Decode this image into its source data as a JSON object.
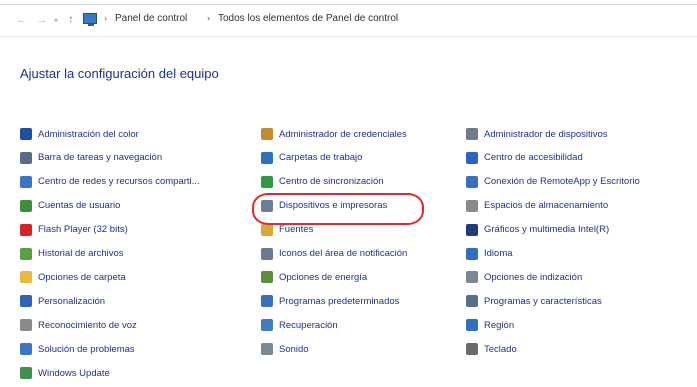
{
  "address_bar": {
    "crumbs": [
      "Panel de control",
      "Todos los elementos de Panel de control"
    ]
  },
  "page_title": "Ajustar la configuración del equipo",
  "columns": [
    [
      {
        "label": "Administración del color",
        "icon": "color-management-icon",
        "color": "#1f4fa3"
      },
      {
        "label": "Barra de tareas y navegación",
        "icon": "taskbar-icon",
        "color": "#5a6b85"
      },
      {
        "label": "Centro de redes y recursos comparti...",
        "icon": "network-icon",
        "color": "#3a73c8"
      },
      {
        "label": "Cuentas de usuario",
        "icon": "user-accounts-icon",
        "color": "#3c8f3c"
      },
      {
        "label": "Flash Player (32 bits)",
        "icon": "flash-player-icon",
        "color": "#d4222a"
      },
      {
        "label": "Historial de archivos",
        "icon": "file-history-icon",
        "color": "#5aa040"
      },
      {
        "label": "Opciones de carpeta",
        "icon": "folder-options-icon",
        "color": "#e8b93e"
      },
      {
        "label": "Personalización",
        "icon": "personalization-icon",
        "color": "#2d63b8"
      },
      {
        "label": "Reconocimiento de voz",
        "icon": "speech-recognition-icon",
        "color": "#8a8a8a"
      },
      {
        "label": "Solución de problemas",
        "icon": "troubleshooting-icon",
        "color": "#3c76c4"
      },
      {
        "label": "Windows Update",
        "icon": "windows-update-icon",
        "color": "#3f8f4a"
      }
    ],
    [
      {
        "label": "Administrador de credenciales",
        "icon": "credential-manager-icon",
        "color": "#c58a2e"
      },
      {
        "label": "Carpetas de trabajo",
        "icon": "work-folders-icon",
        "color": "#2f6fc0"
      },
      {
        "label": "Centro de sincronización",
        "icon": "sync-center-icon",
        "color": "#2e9a3e"
      },
      {
        "label": "Dispositivos e impresoras",
        "icon": "devices-printers-icon",
        "color": "#6b7f96"
      },
      {
        "label": "Fuentes",
        "icon": "fonts-icon",
        "color": "#d9a63a"
      },
      {
        "label": "Iconos del área de notificación",
        "icon": "notification-area-icon",
        "color": "#6a7a8c"
      },
      {
        "label": "Opciones de energía",
        "icon": "power-options-icon",
        "color": "#5b8f3a"
      },
      {
        "label": "Programas predeterminados",
        "icon": "default-programs-icon",
        "color": "#3b6fc0"
      },
      {
        "label": "Recuperación",
        "icon": "recovery-icon",
        "color": "#3f7cc6"
      },
      {
        "label": "Sonido",
        "icon": "sound-icon",
        "color": "#7c8794"
      }
    ],
    [
      {
        "label": "Administrador de dispositivos",
        "icon": "device-manager-icon",
        "color": "#6f7b88"
      },
      {
        "label": "Centro de accesibilidad",
        "icon": "accessibility-icon",
        "color": "#2c66c2"
      },
      {
        "label": "Conexión de RemoteApp y Escritorio",
        "icon": "remoteapp-icon",
        "color": "#3a6fbf"
      },
      {
        "label": "Espacios de almacenamiento",
        "icon": "storage-spaces-icon",
        "color": "#8a8a8a"
      },
      {
        "label": "Gráficos y multimedia Intel(R)",
        "icon": "intel-graphics-icon",
        "color": "#1e3b7a"
      },
      {
        "label": "Idioma",
        "icon": "language-icon",
        "color": "#2f6fc0"
      },
      {
        "label": "Opciones de indización",
        "icon": "indexing-options-icon",
        "color": "#7c8794"
      },
      {
        "label": "Programas y características",
        "icon": "programs-features-icon",
        "color": "#5a6e86"
      },
      {
        "label": "Región",
        "icon": "region-icon",
        "color": "#2f6fc0"
      },
      {
        "label": "Teclado",
        "icon": "keyboard-icon",
        "color": "#6a6a6a"
      }
    ]
  ],
  "highlight_color": "#e8242f"
}
